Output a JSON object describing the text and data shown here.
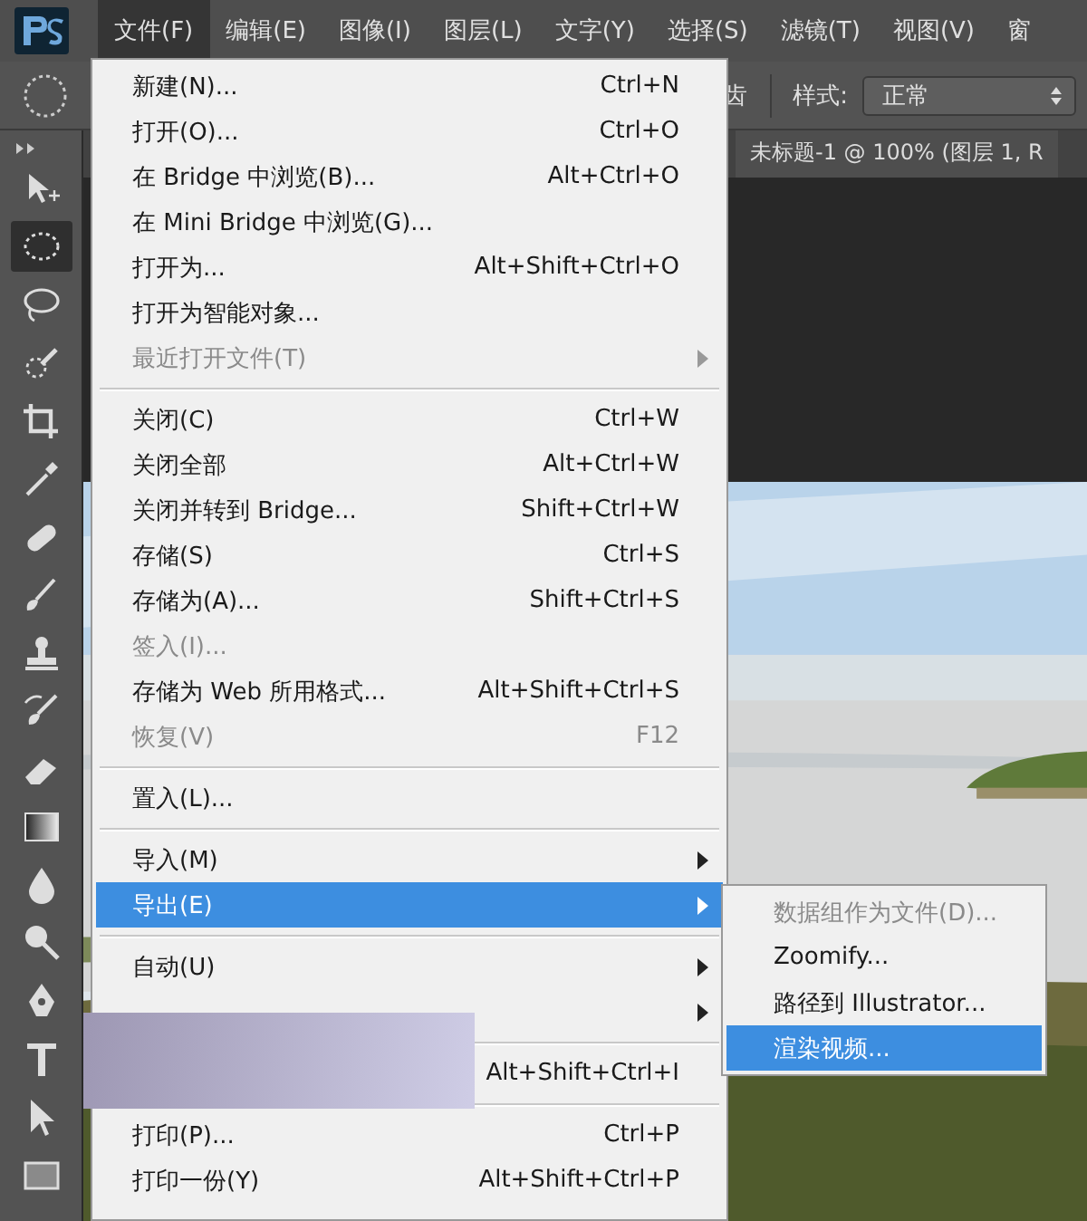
{
  "menubar": {
    "items": [
      {
        "label": "文件(F)",
        "selected": true
      },
      {
        "label": "编辑(E)",
        "selected": false
      },
      {
        "label": "图像(I)",
        "selected": false
      },
      {
        "label": "图层(L)",
        "selected": false
      },
      {
        "label": "文字(Y)",
        "selected": false
      },
      {
        "label": "选择(S)",
        "selected": false
      },
      {
        "label": "滤镜(T)",
        "selected": false
      },
      {
        "label": "视图(V)",
        "selected": false
      },
      {
        "label": "窗",
        "selected": false
      }
    ]
  },
  "options_bar": {
    "antialias_label": "齿",
    "style_label": "样式:",
    "style_value": "正常"
  },
  "document_tab": {
    "title": "未标题-1 @ 100% (图层 1, R"
  },
  "tools": [
    {
      "kind": "move",
      "selected": false
    },
    {
      "kind": "marquee",
      "selected": true
    },
    {
      "kind": "lasso",
      "selected": false
    },
    {
      "kind": "quick",
      "selected": false
    },
    {
      "kind": "crop",
      "selected": false
    },
    {
      "kind": "eyedropper",
      "selected": false
    },
    {
      "kind": "bandage",
      "selected": false
    },
    {
      "kind": "brush",
      "selected": false
    },
    {
      "kind": "stamp",
      "selected": false
    },
    {
      "kind": "history",
      "selected": false
    },
    {
      "kind": "eraser",
      "selected": false
    },
    {
      "kind": "gradient",
      "selected": false
    },
    {
      "kind": "drop",
      "selected": false
    },
    {
      "kind": "dodge",
      "selected": false
    },
    {
      "kind": "pen",
      "selected": false
    },
    {
      "kind": "type",
      "selected": false
    },
    {
      "kind": "pointer",
      "selected": false
    },
    {
      "kind": "rect",
      "selected": false
    }
  ],
  "file_menu": {
    "items": [
      {
        "kind": "item",
        "label": "新建(N)...",
        "shortcut": "Ctrl+N",
        "disabled": false,
        "submenu": false,
        "selected": false
      },
      {
        "kind": "item",
        "label": "打开(O)...",
        "shortcut": "Ctrl+O",
        "disabled": false,
        "submenu": false,
        "selected": false
      },
      {
        "kind": "item",
        "label": "在 Bridge 中浏览(B)...",
        "shortcut": "Alt+Ctrl+O",
        "disabled": false,
        "submenu": false,
        "selected": false
      },
      {
        "kind": "item",
        "label": "在 Mini Bridge 中浏览(G)...",
        "disabled": false,
        "submenu": false,
        "selected": false
      },
      {
        "kind": "item",
        "label": "打开为...",
        "shortcut": "Alt+Shift+Ctrl+O",
        "disabled": false,
        "submenu": false,
        "selected": false
      },
      {
        "kind": "item",
        "label": "打开为智能对象...",
        "disabled": false,
        "submenu": false,
        "selected": false
      },
      {
        "kind": "item",
        "label": "最近打开文件(T)",
        "disabled": true,
        "submenu": true,
        "selected": false
      },
      {
        "kind": "separator"
      },
      {
        "kind": "item",
        "label": "关闭(C)",
        "shortcut": "Ctrl+W",
        "disabled": false,
        "submenu": false,
        "selected": false
      },
      {
        "kind": "item",
        "label": "关闭全部",
        "shortcut": "Alt+Ctrl+W",
        "disabled": false,
        "submenu": false,
        "selected": false
      },
      {
        "kind": "item",
        "label": "关闭并转到 Bridge...",
        "shortcut": "Shift+Ctrl+W",
        "disabled": false,
        "submenu": false,
        "selected": false
      },
      {
        "kind": "item",
        "label": "存储(S)",
        "shortcut": "Ctrl+S",
        "disabled": false,
        "submenu": false,
        "selected": false
      },
      {
        "kind": "item",
        "label": "存储为(A)...",
        "shortcut": "Shift+Ctrl+S",
        "disabled": false,
        "submenu": false,
        "selected": false
      },
      {
        "kind": "item",
        "label": "签入(I)...",
        "disabled": true,
        "submenu": false,
        "selected": false
      },
      {
        "kind": "item",
        "label": "存储为 Web 所用格式...",
        "shortcut": "Alt+Shift+Ctrl+S",
        "disabled": false,
        "submenu": false,
        "selected": false
      },
      {
        "kind": "item",
        "label": "恢复(V)",
        "shortcut": "F12",
        "disabled": true,
        "submenu": false,
        "selected": false
      },
      {
        "kind": "separator"
      },
      {
        "kind": "item",
        "label": "置入(L)...",
        "disabled": false,
        "submenu": false,
        "selected": false
      },
      {
        "kind": "separator"
      },
      {
        "kind": "item",
        "label": "导入(M)",
        "disabled": false,
        "submenu": true,
        "selected": false
      },
      {
        "kind": "item",
        "label": "导出(E)",
        "disabled": false,
        "submenu": true,
        "selected": true
      },
      {
        "kind": "separator"
      },
      {
        "kind": "item",
        "label": "自动(U)",
        "disabled": false,
        "submenu": true,
        "selected": false
      },
      {
        "kind": "item",
        "disabled": false,
        "submenu": true,
        "selected": false
      },
      {
        "kind": "separator"
      },
      {
        "kind": "item",
        "shortcut": "Alt+Shift+Ctrl+I",
        "disabled": false,
        "submenu": false,
        "selected": false
      },
      {
        "kind": "separator"
      },
      {
        "kind": "item",
        "label": "打印(P)...",
        "shortcut": "Ctrl+P",
        "disabled": false,
        "submenu": false,
        "selected": false
      },
      {
        "kind": "item",
        "label": "打印一份(Y)",
        "shortcut": "Alt+Shift+Ctrl+P",
        "disabled": false,
        "submenu": false,
        "selected": false
      }
    ]
  },
  "export_submenu": {
    "items": [
      {
        "label": "数据组作为文件(D)...",
        "disabled": true,
        "selected": false
      },
      {
        "label": "Zoomify...",
        "disabled": false,
        "selected": false
      },
      {
        "label": "路径到 Illustrator...",
        "disabled": false,
        "selected": false
      },
      {
        "label": "渲染视频...",
        "disabled": false,
        "selected": true
      }
    ]
  }
}
